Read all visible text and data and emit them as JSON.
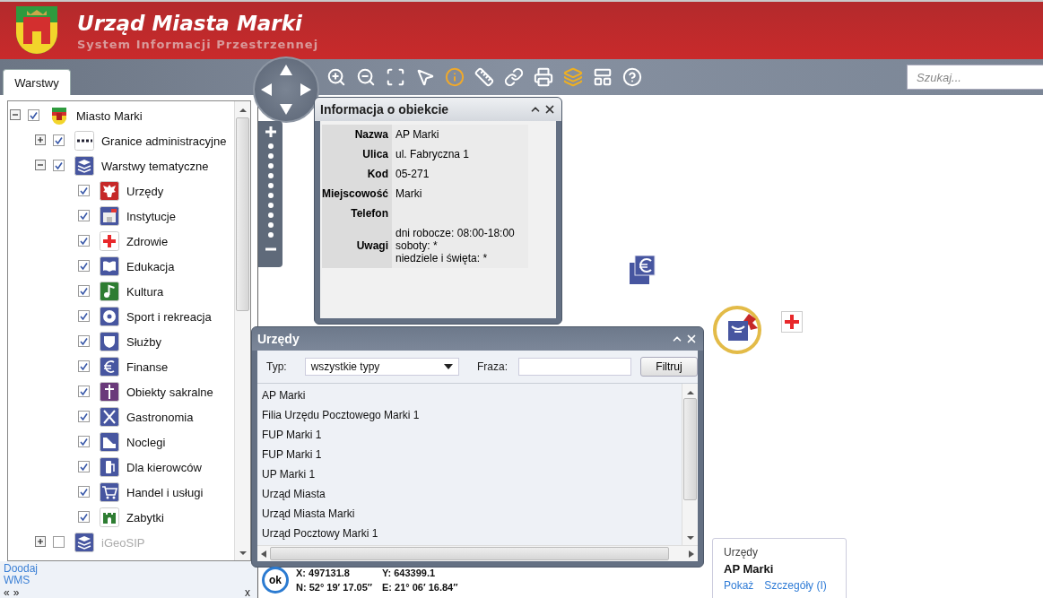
{
  "header": {
    "title": "Urząd Miasta Marki",
    "subtitle": "System Informacji Przestrzennej"
  },
  "tabs": [
    {
      "label": "Warstwy",
      "selected": true
    }
  ],
  "search": {
    "placeholder": "Szukaj..."
  },
  "layers": [
    {
      "label": "Miasto Marki",
      "kind": "city",
      "checked": true,
      "disabled": false,
      "expanded": true,
      "children": [
        {
          "label": "Granice administracyjne",
          "kind": "line",
          "checked": true,
          "disabled": false,
          "expanded": false
        },
        {
          "label": "Warstwy tematyczne",
          "kind": "layers",
          "checked": true,
          "disabled": false,
          "expanded": true,
          "children": [
            {
              "label": "Urzędy",
              "kind": "office",
              "checked": true,
              "disabled": false
            },
            {
              "label": "Instytucje",
              "kind": "institution",
              "checked": true,
              "disabled": false
            },
            {
              "label": "Zdrowie",
              "kind": "health",
              "checked": true,
              "disabled": false
            },
            {
              "label": "Edukacja",
              "kind": "education",
              "checked": true,
              "disabled": false
            },
            {
              "label": "Kultura",
              "kind": "culture",
              "checked": true,
              "disabled": false
            },
            {
              "label": "Sport i rekreacja",
              "kind": "sport",
              "checked": true,
              "disabled": false
            },
            {
              "label": "Służby",
              "kind": "services",
              "checked": true,
              "disabled": false
            },
            {
              "label": "Finanse",
              "kind": "finance",
              "checked": true,
              "disabled": false
            },
            {
              "label": "Obiekty sakralne",
              "kind": "sacral",
              "checked": true,
              "disabled": false
            },
            {
              "label": "Gastronomia",
              "kind": "food",
              "checked": true,
              "disabled": false
            },
            {
              "label": "Noclegi",
              "kind": "lodging",
              "checked": true,
              "disabled": false
            },
            {
              "label": "Dla kierowców",
              "kind": "drivers",
              "checked": true,
              "disabled": false
            },
            {
              "label": "Handel i usługi",
              "kind": "shop",
              "checked": true,
              "disabled": false
            },
            {
              "label": "Zabytki",
              "kind": "monument",
              "checked": true,
              "disabled": false
            }
          ]
        },
        {
          "label": "iGeoSIP",
          "kind": "layers",
          "checked": false,
          "disabled": true,
          "expanded": false
        }
      ]
    }
  ],
  "left_footer": {
    "link": "Doodaj WMS",
    "prev": "«",
    "next": "»",
    "close": "x"
  },
  "info_window": {
    "title": "Informacja o obiekcie",
    "rows": [
      {
        "label": "Nazwa",
        "value": "AP Marki"
      },
      {
        "label": "Ulica",
        "value": "ul. Fabryczna 1"
      },
      {
        "label": "Kod",
        "value": "05-271"
      },
      {
        "label": "Miejscowość",
        "value": "Marki"
      },
      {
        "label": "Telefon"
      },
      {
        "label": "Uwagi",
        "value": "dni robocze: 08:00-18:00\nsoboty: *\nniedziele i święta: *"
      }
    ]
  },
  "list_window": {
    "title": "Urzędy",
    "type_label": "Typ:",
    "type_value": "wszystkie typy",
    "phrase_label": "Fraza:",
    "button": "Filtruj",
    "items": [
      "AP Marki",
      "Filia Urzędu Pocztowego Marki 1",
      "FUP Marki 1",
      "FUP Marki 1",
      "UP Marki 1",
      "Urząd Miasta",
      "Urząd Miasta Marki",
      "Urząd Pocztowy Marki 1"
    ]
  },
  "coordinates": {
    "status": "ok",
    "x": "X: 497131.8",
    "y": "Y: 643399.1",
    "n": "N: 52° 19′ 17.05″",
    "e": "E: 21° 06′ 16.84″"
  },
  "popup": {
    "category": "Urzędy",
    "name": "AP Marki",
    "links": [
      "Pokaż",
      "Szczegóły (I)"
    ]
  }
}
